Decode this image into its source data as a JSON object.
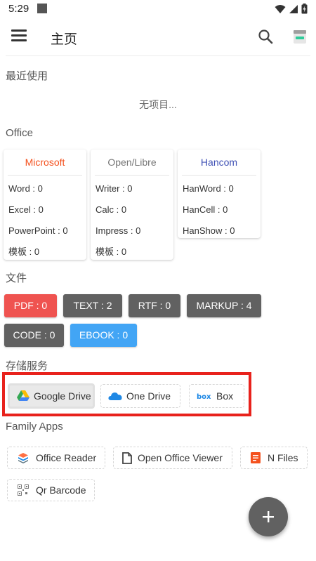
{
  "status_bar": {
    "time": "5:29"
  },
  "app_bar": {
    "title": "主页"
  },
  "recent": {
    "title": "最近使用",
    "empty_text": "无项目..."
  },
  "office": {
    "title": "Office",
    "cards": [
      {
        "name": "Microsoft",
        "color": "#f4511e",
        "items": [
          "Word : 0",
          "Excel : 0",
          "PowerPoint : 0",
          "模板 : 0"
        ]
      },
      {
        "name": "Open/Libre",
        "color": "#757575",
        "items": [
          "Writer : 0",
          "Calc : 0",
          "Impress : 0",
          "模板 : 0"
        ]
      },
      {
        "name": "Hancom",
        "color": "#3f51b5",
        "items": [
          "HanWord : 0",
          "HanCell : 0",
          "HanShow : 0"
        ]
      }
    ]
  },
  "files": {
    "title": "文件",
    "chips": [
      {
        "label": "PDF : 0",
        "color": "#ef5350"
      },
      {
        "label": "TEXT : 2",
        "color": "#616161"
      },
      {
        "label": "RTF : 0",
        "color": "#616161"
      },
      {
        "label": "MARKUP : 4",
        "color": "#616161"
      },
      {
        "label": "CODE : 0",
        "color": "#616161"
      },
      {
        "label": "EBOOK : 0",
        "color": "#42a5f5"
      }
    ]
  },
  "storage": {
    "title": "存储服务",
    "items": [
      {
        "label": "Google Drive",
        "icon": "google-drive-icon"
      },
      {
        "label": "One Drive",
        "icon": "onedrive-icon"
      },
      {
        "label": "Box",
        "icon": "box-icon"
      }
    ]
  },
  "family": {
    "title": "Family Apps",
    "items": [
      {
        "label": "Office Reader",
        "icon": "office-reader-icon"
      },
      {
        "label": "Open Office Viewer",
        "icon": "document-icon"
      },
      {
        "label": "N Files",
        "icon": "n-files-icon"
      },
      {
        "label": "Qr Barcode",
        "icon": "qr-code-icon"
      }
    ]
  },
  "colors": {
    "highlight": "#e8221c",
    "fab": "#616161"
  }
}
